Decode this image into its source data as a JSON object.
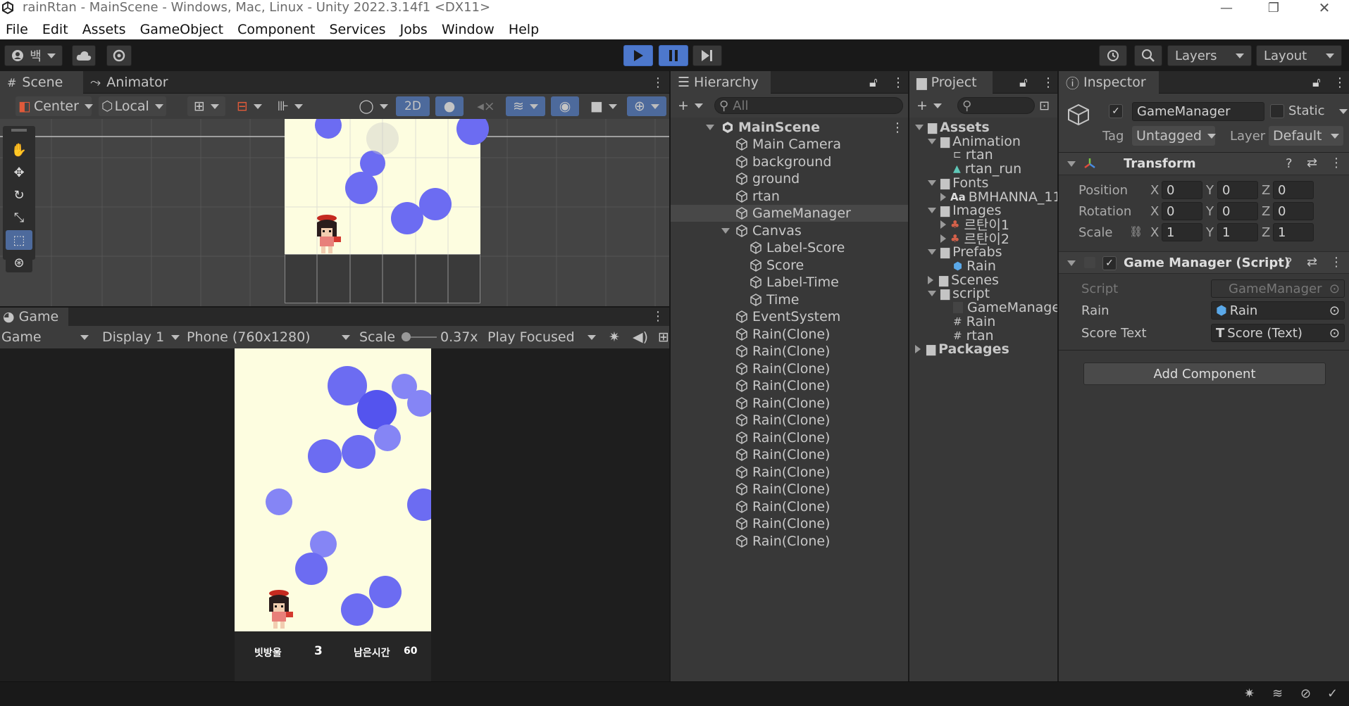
{
  "window": {
    "title": "rainRtan - MainScene - Windows, Mac, Linux - Unity 2022.3.14f1 <DX11>"
  },
  "menu": [
    "File",
    "Edit",
    "Assets",
    "GameObject",
    "Component",
    "Services",
    "Jobs",
    "Window",
    "Help"
  ],
  "toolbar": {
    "account_label": "백",
    "layers_label": "Layers",
    "layout_label": "Layout"
  },
  "scene_panel": {
    "tabs": [
      "Scene",
      "Animator"
    ],
    "pivot_label": "Center",
    "space_label": "Local",
    "mode_2d_label": "2D"
  },
  "game_panel": {
    "tab": "Game",
    "view_label": "Game",
    "display_label": "Display 1",
    "resolution_label": "Phone (760x1280)",
    "scale_label": "Scale",
    "scale_value": "0.37x",
    "play_mode_label": "Play Focused",
    "hud": {
      "score_label": "빗방울",
      "score_value": "3",
      "time_label": "남은시간",
      "time_value": "60"
    }
  },
  "hierarchy": {
    "tab": "Hierarchy",
    "search_placeholder": "All",
    "scene_name": "MainScene",
    "items": [
      {
        "label": "Main Camera",
        "depth": 1
      },
      {
        "label": "background",
        "depth": 1
      },
      {
        "label": "ground",
        "depth": 1
      },
      {
        "label": "rtan",
        "depth": 1
      },
      {
        "label": "GameManager",
        "depth": 1,
        "selected": true
      },
      {
        "label": "Canvas",
        "depth": 1,
        "expanded": true
      },
      {
        "label": "Label-Score",
        "depth": 2
      },
      {
        "label": "Score",
        "depth": 2
      },
      {
        "label": "Label-Time",
        "depth": 2
      },
      {
        "label": "Time",
        "depth": 2
      },
      {
        "label": "EventSystem",
        "depth": 1
      },
      {
        "label": "Rain(Clone)",
        "depth": 1
      },
      {
        "label": "Rain(Clone)",
        "depth": 1
      },
      {
        "label": "Rain(Clone)",
        "depth": 1
      },
      {
        "label": "Rain(Clone)",
        "depth": 1
      },
      {
        "label": "Rain(Clone)",
        "depth": 1
      },
      {
        "label": "Rain(Clone)",
        "depth": 1
      },
      {
        "label": "Rain(Clone)",
        "depth": 1
      },
      {
        "label": "Rain(Clone)",
        "depth": 1
      },
      {
        "label": "Rain(Clone)",
        "depth": 1
      },
      {
        "label": "Rain(Clone)",
        "depth": 1
      },
      {
        "label": "Rain(Clone)",
        "depth": 1
      },
      {
        "label": "Rain(Clone)",
        "depth": 1
      },
      {
        "label": "Rain(Clone)",
        "depth": 1
      }
    ]
  },
  "project": {
    "tab": "Project",
    "tree": [
      {
        "label": "Assets",
        "type": "folder",
        "depth": 0,
        "bold": true
      },
      {
        "label": "Animation",
        "type": "folder",
        "depth": 1
      },
      {
        "label": "rtan",
        "type": "animator",
        "depth": 2
      },
      {
        "label": "rtan_run",
        "type": "anim",
        "depth": 2
      },
      {
        "label": "Fonts",
        "type": "folder",
        "depth": 1
      },
      {
        "label": "BMHANNA_11",
        "type": "font",
        "depth": 2
      },
      {
        "label": "Images",
        "type": "folder",
        "depth": 1
      },
      {
        "label": "르탄이1",
        "type": "sprite",
        "depth": 2
      },
      {
        "label": "르탄이2",
        "type": "sprite",
        "depth": 2
      },
      {
        "label": "Prefabs",
        "type": "folder",
        "depth": 1
      },
      {
        "label": "Rain",
        "type": "prefab",
        "depth": 2
      },
      {
        "label": "Scenes",
        "type": "folder",
        "depth": 1
      },
      {
        "label": "script",
        "type": "folder",
        "depth": 1
      },
      {
        "label": "GameManager",
        "type": "script-blank",
        "depth": 2
      },
      {
        "label": "Rain",
        "type": "script",
        "depth": 2
      },
      {
        "label": "rtan",
        "type": "script",
        "depth": 2
      },
      {
        "label": "Packages",
        "type": "folder",
        "depth": 0,
        "bold": true
      }
    ]
  },
  "inspector": {
    "tab": "Inspector",
    "object_name": "GameManager",
    "static_label": "Static",
    "tag_label": "Tag",
    "tag_value": "Untagged",
    "layer_label": "Layer",
    "layer_value": "Default",
    "transform": {
      "title": "Transform",
      "position_label": "Position",
      "rotation_label": "Rotation",
      "scale_label": "Scale",
      "position": [
        "0",
        "0",
        "0"
      ],
      "rotation": [
        "0",
        "0",
        "0"
      ],
      "scale": [
        "1",
        "1",
        "1"
      ]
    },
    "script_component": {
      "title": "Game Manager (Script)",
      "script_label": "Script",
      "script_value": "GameManager",
      "rain_label": "Rain",
      "rain_value": "Rain",
      "score_text_label": "Score Text",
      "score_text_value": "Score (Text)"
    },
    "add_component_label": "Add Component"
  },
  "colors": {
    "accent": "#4d78cc",
    "game_bg": "#fdfde0",
    "rain": "#6c6cf2"
  }
}
